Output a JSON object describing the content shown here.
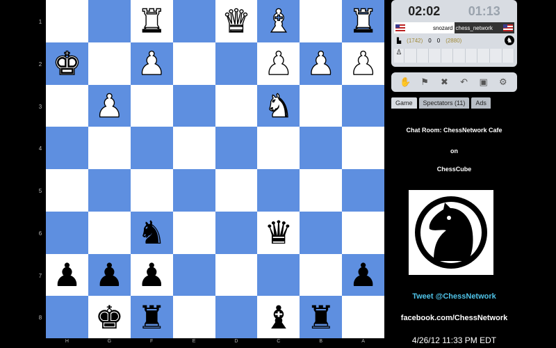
{
  "board": {
    "rank_labels": [
      "1",
      "2",
      "3",
      "4",
      "5",
      "6",
      "7",
      "8"
    ],
    "file_labels": [
      "H",
      "G",
      "F",
      "E",
      "D",
      "C",
      "B",
      "A"
    ],
    "squares": [
      [
        "",
        "",
        "wR",
        "",
        "wQ",
        "wB",
        "",
        "wR"
      ],
      [
        "wK",
        "",
        "wP",
        "",
        "",
        "wP",
        "wP",
        "wP"
      ],
      [
        "",
        "wP",
        "",
        "",
        "",
        "wN",
        "",
        ""
      ],
      [
        "",
        "",
        "",
        "",
        "",
        "",
        "",
        ""
      ],
      [
        "",
        "",
        "",
        "",
        "",
        "",
        "",
        ""
      ],
      [
        "",
        "",
        "bN",
        "",
        "",
        "bQ",
        "",
        ""
      ],
      [
        "bP",
        "bP",
        "bP",
        "",
        "",
        "",
        "",
        "bP"
      ],
      [
        "",
        "bK",
        "bR",
        "",
        "",
        "bB",
        "bR",
        ""
      ]
    ]
  },
  "glyphs": {
    "K": "♚",
    "Q": "♛",
    "R": "♜",
    "B": "♝",
    "N": "♞",
    "P": "♟"
  },
  "clock": {
    "player_time": "02:02",
    "opponent_time": "01:13",
    "player_name": "snozard",
    "opponent_name": "chess_network",
    "player_rating": "(1742)",
    "player_score": "0",
    "opponent_score": "0",
    "opponent_rating": "(2880)"
  },
  "tabs": [
    {
      "label": "Game",
      "active": true
    },
    {
      "label": "Spectators (11)",
      "active": false
    },
    {
      "label": "Ads",
      "active": false
    }
  ],
  "chat": {
    "line1": "Chat Room: ChessNetwork Cafe",
    "line2": "on",
    "line3": "ChessCube"
  },
  "social": {
    "twitter": "Tweet @ChessNetwork",
    "facebook": "facebook.com/ChessNetwork"
  },
  "datetime": "4/26/12 11:33 PM EDT",
  "colors": {
    "dark_square": "#5e8fe0",
    "light_square": "#ffffff",
    "twitter": "#4fc3e8"
  }
}
